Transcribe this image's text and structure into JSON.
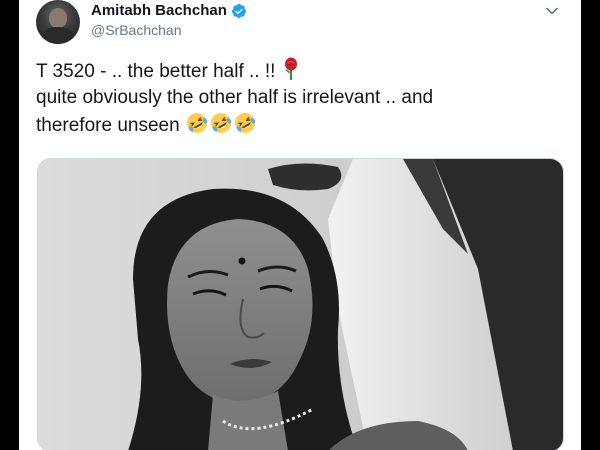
{
  "tweet": {
    "author": {
      "display_name": "Amitabh Bachchan",
      "handle": "@SrBachchan",
      "verified": true,
      "avatar_icon": "profile-photo"
    },
    "text_lines": [
      "T 3520 - .. the better half .. !!",
      "quite obviously the other half is irrelevant  .. and",
      "therefore unseen"
    ],
    "emojis": {
      "line1": "rose",
      "line3": [
        "rolling-on-floor-laughing",
        "rolling-on-floor-laughing",
        "rolling-on-floor-laughing"
      ]
    },
    "menu_icon": "chevron-down-icon",
    "media": {
      "type": "black-and-white photo"
    }
  },
  "colors": {
    "text": "#14171a",
    "secondary": "#657786",
    "verified": "#1da1f2",
    "border": "#ccd6dd"
  }
}
